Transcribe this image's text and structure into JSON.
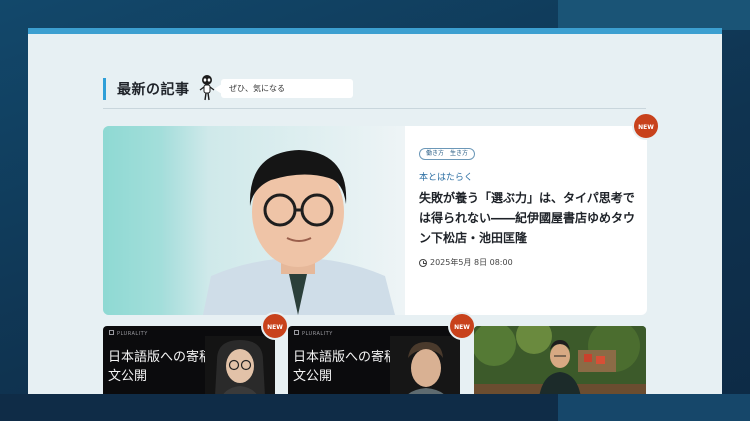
{
  "section": {
    "title": "最新の記事",
    "speech": "ぜひ、気になる"
  },
  "feature": {
    "badge": "NEW",
    "tag": "働き方　生き方",
    "category": "本とはたらく",
    "title": "失敗が養う「選ぶ力」は、タイパ思考では得られない――紀伊國屋書店ゆめタウン下松店・池田匡隆",
    "date": "2025年5月 8日 08:00"
  },
  "cards": [
    {
      "badge": "NEW",
      "brand": "PLURALITY",
      "title": "日本語版への寄稿文公開"
    },
    {
      "badge": "NEW",
      "brand": "PLURALITY",
      "title": "日本語版への寄稿文公開"
    },
    {
      "badge": ""
    }
  ],
  "colors": {
    "accent": "#2f9fd8",
    "new_badge": "#c8421c",
    "category": "#2d6fa3"
  }
}
